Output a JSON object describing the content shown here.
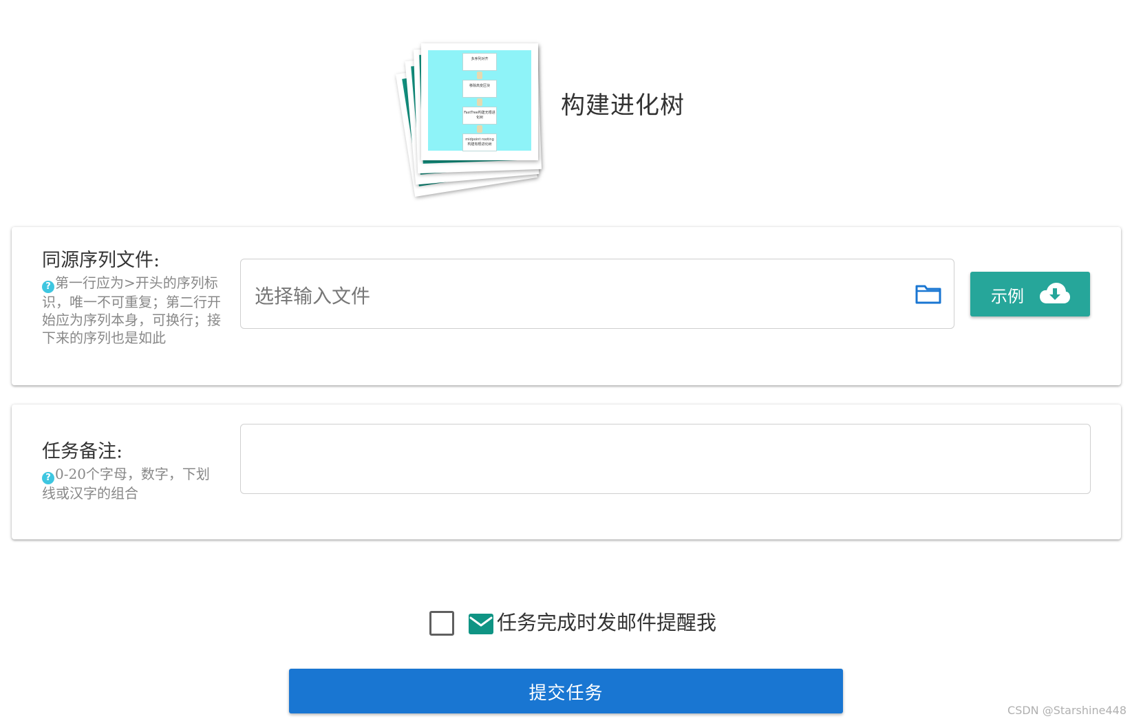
{
  "header": {
    "title": "构建进化树",
    "flow_steps": [
      "多序列对齐",
      "移除高变区块",
      "FastTree构建无根进化树",
      "midpoint rooting 构建有根进化树"
    ]
  },
  "sequence_file": {
    "label": "同源序列文件:",
    "hint": "第一行应为>开头的序列标识，唯一不可重复；第二行开始应为序列本身，可换行；接下来的序列也是如此",
    "placeholder": "选择输入文件",
    "example_button": "示例"
  },
  "task_note": {
    "label": "任务备注:",
    "hint": "0-20个字母，数字，下划线或汉字的组合",
    "value": ""
  },
  "email_reminder": {
    "label": "任务完成时发邮件提醒我",
    "checked": false
  },
  "submit": {
    "label": "提交任务"
  },
  "watermark": "CSDN @Starshine448",
  "icons": {
    "help": "help-icon",
    "folder": "folder-icon",
    "cloud_download": "cloud-download-icon",
    "mail": "mail-icon"
  },
  "colors": {
    "teal": "#26a69a",
    "primary_blue": "#1976d2",
    "help_blue": "#3ec6e0",
    "folder_blue": "#1976d2"
  }
}
